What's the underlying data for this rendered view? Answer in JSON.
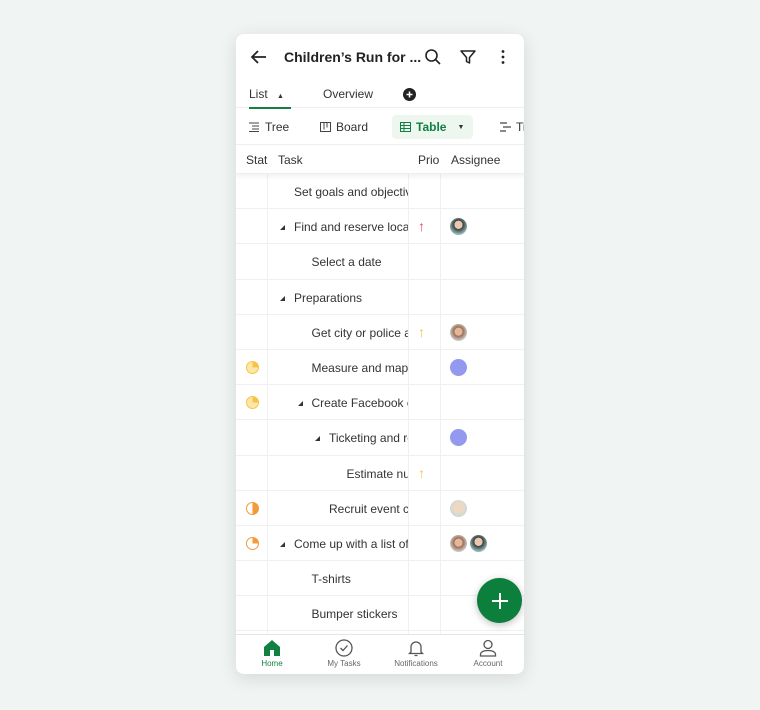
{
  "header": {
    "title": "Children’s Run for ..."
  },
  "tabs": [
    {
      "label": "List"
    },
    {
      "label": "Overview"
    }
  ],
  "views": [
    {
      "label": "Tree"
    },
    {
      "label": "Board"
    },
    {
      "label": "Table"
    },
    {
      "label": "Ti"
    }
  ],
  "columns": {
    "status": "Stat",
    "task": "Task",
    "priority": "Prio",
    "assignee": "Assignee"
  },
  "colors": {
    "accent": "#108043",
    "yellow": "#f6c445",
    "orange": "#f39a3b",
    "red": "#e6455b",
    "purple": "#9399ef"
  },
  "rows": [
    {
      "task": "Set goals and objectives",
      "level": 0,
      "caret": false
    },
    {
      "task": "Find and reserve location",
      "level": 0,
      "caret": true,
      "priority": "high",
      "assignees": [
        "photo-a"
      ]
    },
    {
      "task": "Select a date",
      "level": 1,
      "caret": false
    },
    {
      "task": "Preparations",
      "level": 0,
      "caret": true
    },
    {
      "task": "Get city or police approval",
      "level": 1,
      "caret": false,
      "priority": "medium",
      "assignees": [
        "photo-b"
      ]
    },
    {
      "task": "Measure and map",
      "level": 1,
      "caret": false,
      "status": "yellow-quarter",
      "assignees": [
        "purple"
      ]
    },
    {
      "task": "Create Facebook event",
      "level": 1,
      "caret": true,
      "status": "yellow-quarter"
    },
    {
      "task": "Ticketing and registration",
      "level": 2,
      "caret": true,
      "assignees": [
        "purple"
      ]
    },
    {
      "task": "Estimate number",
      "level": 3,
      "caret": false,
      "priority": "medium"
    },
    {
      "task": "Recruit event crew",
      "level": 2,
      "caret": false,
      "status": "orange-half",
      "assignees": [
        "photo-c"
      ]
    },
    {
      "task": "Come up with a list of",
      "level": 0,
      "caret": true,
      "status": "orange-quarter",
      "assignees": [
        "photo-b",
        "photo-a"
      ]
    },
    {
      "task": "T-shirts",
      "level": 1,
      "caret": false
    },
    {
      "task": "Bumper stickers",
      "level": 1,
      "caret": false
    }
  ],
  "footer": [
    {
      "label": "Home"
    },
    {
      "label": "My Tasks"
    },
    {
      "label": "Notifications"
    },
    {
      "label": "Account"
    }
  ]
}
